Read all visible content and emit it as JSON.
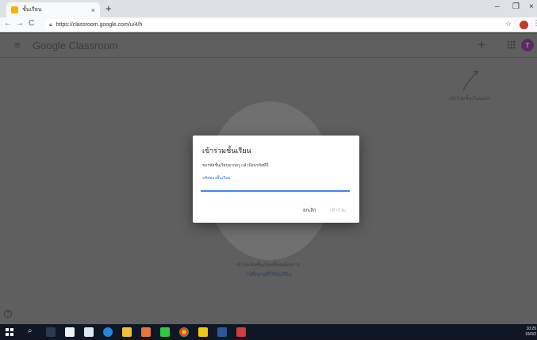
{
  "browser": {
    "tab_title": "ชั้นเรียน",
    "tab_close": "×",
    "new_tab": "+",
    "window_controls": [
      "–",
      "❐",
      "×"
    ],
    "nav": {
      "back": "←",
      "forward": "→",
      "reload": "C"
    },
    "url": "https://classroom.google.com/u/4/h",
    "star": "☆",
    "menu": "⋮"
  },
  "app": {
    "menu_icon": "≡",
    "brand_google": "Google",
    "brand_product": "Classroom",
    "add_icon": "+",
    "avatar_initial": "T",
    "avatar_color": "#5b2a63",
    "join_hint": "เข้าร่วมชั้นเรียนแรก",
    "empty_text": "ทำไม่เห็นชั้นเรียนที่คุณต้องการ",
    "empty_link": "ไปที่คลาสที่ใช้บัญชีอื่น",
    "help_icon": "?"
  },
  "dialog": {
    "title": "เข้าร่วมชั้นเรียน",
    "description": "ขอรหัสชั้นเรียนจากครู แล้วป้อนรหัสที่นี่",
    "field_label": "รหัสของชั้นเรียน",
    "field_value": "",
    "cancel_label": "ยกเลิก",
    "join_label": "เข้าร่วม",
    "accent_color": "#4285f4"
  },
  "taskbar": {
    "search_icon": "⌕",
    "clock_time": "10:25",
    "clock_date": "19/3/2"
  }
}
